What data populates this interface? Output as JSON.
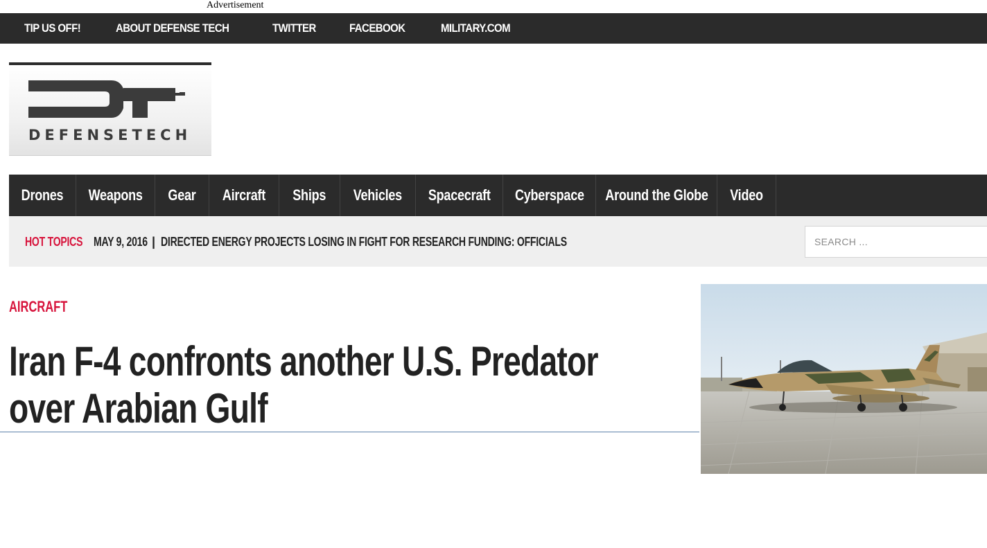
{
  "advertisement_label": "Advertisement",
  "top_nav": {
    "items": [
      "TIP US OFF!",
      "ABOUT DEFENSE TECH",
      "TWITTER",
      "FACEBOOK",
      "MILITARY.COM"
    ]
  },
  "logo": {
    "text": "DEFENSETECH",
    "icon": "dt-logo-icon"
  },
  "main_nav": {
    "items": [
      "Drones",
      "Weapons",
      "Gear",
      "Aircraft",
      "Ships",
      "Vehicles",
      "Spacecraft",
      "Cyberspace",
      "Around the Globe",
      "Video"
    ]
  },
  "hot_topics": {
    "label": "HOT TOPICS",
    "date": "MAY 9, 2016",
    "separator": "|",
    "headline": "DIRECTED ENERGY PROJECTS LOSING IN FIGHT FOR RESEARCH FUNDING: OFFICIALS"
  },
  "search": {
    "placeholder": "SEARCH ...",
    "value": ""
  },
  "article": {
    "category": "AIRCRAFT",
    "title": "Iran F-4 confronts another U.S. Predator over Arabian Gulf",
    "image": "f4-phantom-photo"
  },
  "colors": {
    "dark_bar": "#2b2b2b",
    "accent_red": "#d7143c",
    "hot_bar_bg": "#efefef"
  }
}
